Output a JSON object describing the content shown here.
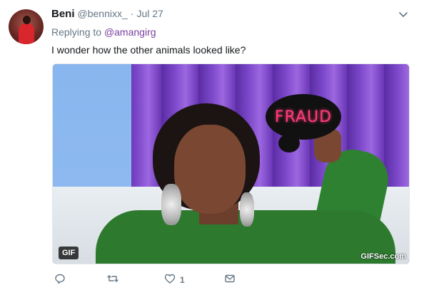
{
  "tweet": {
    "author_name": "Beni",
    "author_handle": "@bennixx_",
    "separator": "·",
    "date": "Jul 27",
    "replying_prefix": "Replying to",
    "replying_to": "@amangirg",
    "text": "I wonder how the other animals looked like?"
  },
  "media": {
    "type": "gif",
    "badge": "GIF",
    "sign_text": "FRAUD",
    "watermark": "GIFSec.com"
  },
  "actions": {
    "reply_icon": "reply-icon",
    "retweet_icon": "retweet-icon",
    "like_icon": "heart-icon",
    "like_count": "1",
    "message_icon": "envelope-icon"
  },
  "colors": {
    "mention": "#7a3f9d",
    "muted": "#657786",
    "text": "#14171a"
  }
}
